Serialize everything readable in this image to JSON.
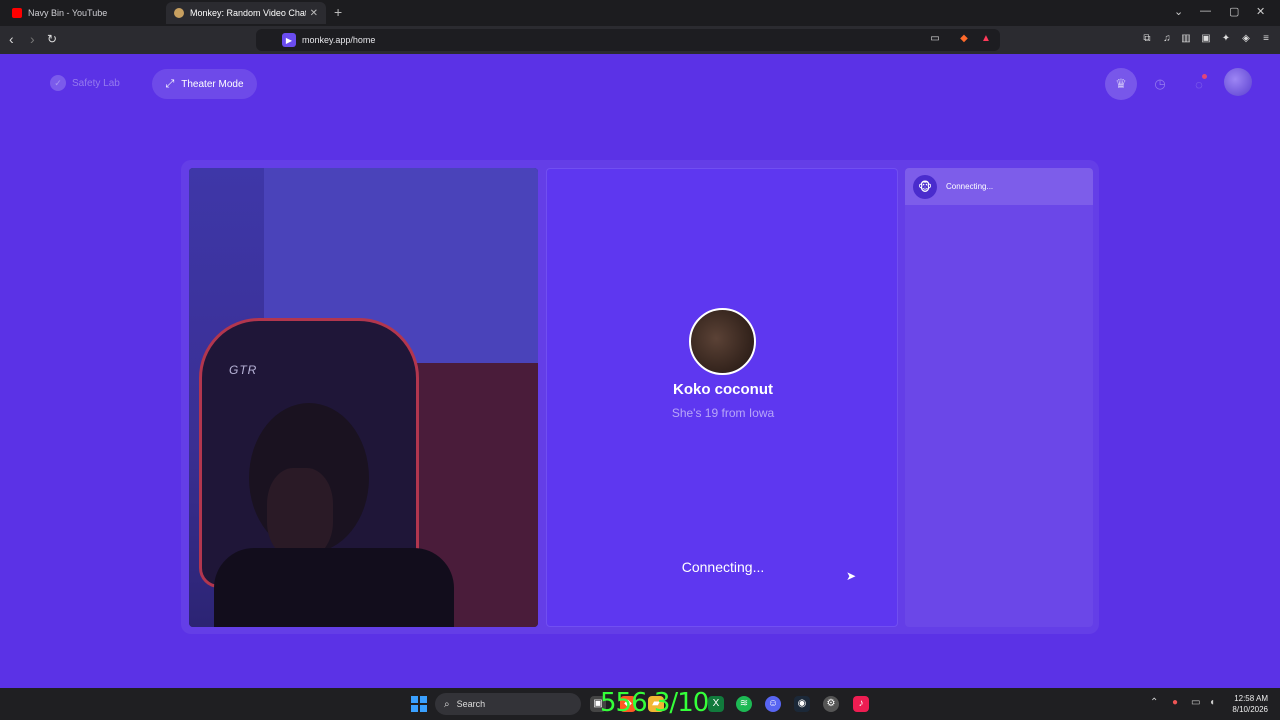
{
  "browser": {
    "tabs": [
      {
        "title": "Navy Bin - YouTube",
        "favicon_color": "#ff0000",
        "active": false
      },
      {
        "title": "Monkey: Random Video Chat",
        "favicon_color": "#c8a060",
        "active": true
      }
    ],
    "url": "monkey.app/home"
  },
  "header": {
    "safety_lab_label": "Safety Lab",
    "theater_mode_label": "Theater Mode"
  },
  "match": {
    "name": "Koko coconut",
    "subtitle": "She's 19 from Iowa",
    "status": "Connecting..."
  },
  "side_panel": {
    "items": [
      {
        "label": "Connecting..."
      }
    ]
  },
  "camera": {
    "chair_text": "GTR"
  },
  "taskbar": {
    "search_label": "Search",
    "overlay_counter": "556 3/10",
    "time": "12:58 AM",
    "date": "8/10/2026"
  }
}
